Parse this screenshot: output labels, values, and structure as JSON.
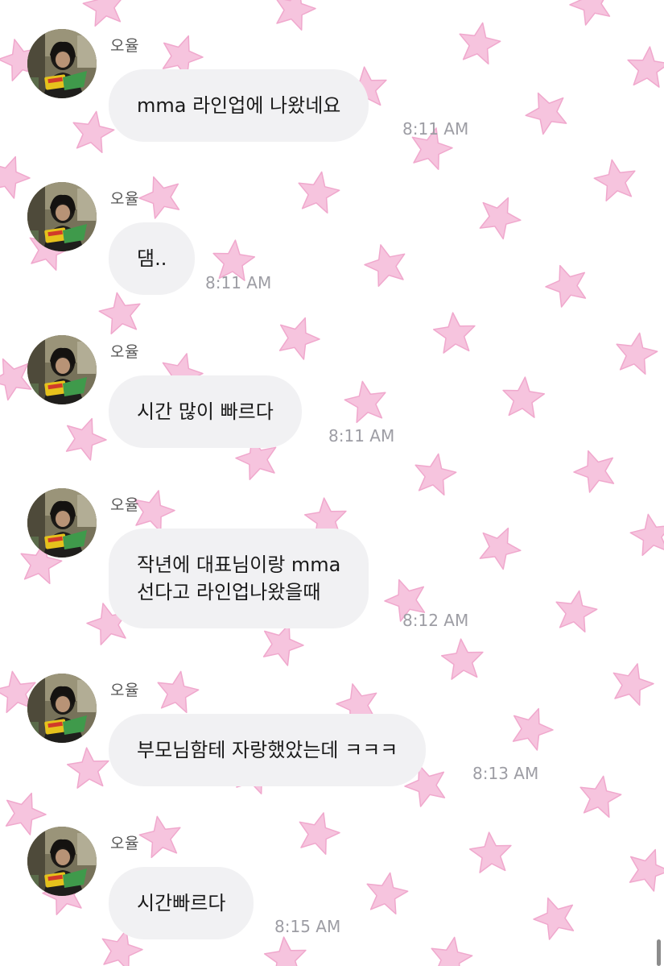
{
  "theme": {
    "star_color": "#f6c4de",
    "star_stroke": "#f0a8cd",
    "bubble_color": "#f1f1f3",
    "time_color": "#9d9da4"
  },
  "messages": [
    {
      "sender": "오율",
      "lines": [
        "mma 라인업에 나왔네요"
      ],
      "time": "8:11 AM"
    },
    {
      "sender": "오율",
      "lines": [
        "댐.."
      ],
      "time": "8:11 AM"
    },
    {
      "sender": "오율",
      "lines": [
        "시간 많이 빠르다"
      ],
      "time": "8:11 AM"
    },
    {
      "sender": "오율",
      "lines": [
        "작년에 대표님이랑 mma",
        "선다고 라인업나왔을때"
      ],
      "time": "8:12 AM"
    },
    {
      "sender": "오율",
      "lines": [
        "부모님함테 자랑했았는데 ㅋㅋㅋ"
      ],
      "time": "8:13 AM"
    },
    {
      "sender": "오율",
      "lines": [
        "시간빠르다"
      ],
      "time": "8:15 AM"
    }
  ]
}
